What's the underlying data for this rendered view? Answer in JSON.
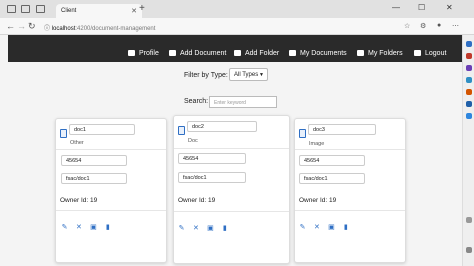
{
  "browser": {
    "tab_title": "Client",
    "url_host": "localhost",
    "url_path": ":4200/document-management",
    "close_glyph": "✕",
    "new_tab_glyph": "+",
    "minimize_glyph": "—",
    "maximize_glyph": "☐",
    "window_close_glyph": "✕",
    "back_glyph": "←",
    "forward_glyph": "→",
    "reload_glyph": "↻",
    "info_glyph": "ⓘ"
  },
  "navbar": {
    "items": [
      {
        "label": "Profile",
        "icon": "user-icon"
      },
      {
        "label": "Add Document",
        "icon": "file-icon"
      },
      {
        "label": "Add Folder",
        "icon": "folder-icon"
      },
      {
        "label": "My Documents",
        "icon": "book-icon"
      },
      {
        "label": "My Folders",
        "icon": "folder-icon"
      },
      {
        "label": "Logout",
        "icon": "logout-icon"
      }
    ]
  },
  "filters": {
    "type_label": "Filter by Type:",
    "type_value": "All Types",
    "search_label": "Search:",
    "search_placeholder": "Enter keyword"
  },
  "documents": [
    {
      "name": "doc1",
      "type": "Other",
      "size": "45654",
      "path": "fsac/doc1",
      "owner": "Owner Id: 19"
    },
    {
      "name": "doc2",
      "type": "Doc",
      "size": "45654",
      "path": "fsac/doc1",
      "owner": "Owner Id: 19"
    },
    {
      "name": "doc3",
      "type": "Image",
      "size": "45654",
      "path": "fsac/doc1",
      "owner": "Owner Id: 19"
    }
  ],
  "actions": {
    "edit_glyph": "✎",
    "delete_x_glyph": "✕",
    "save_glyph": "▣",
    "trash_glyph": "▮"
  },
  "colors": {
    "navbar_bg": "#2a2a2a",
    "accent": "#2f6fc4"
  }
}
